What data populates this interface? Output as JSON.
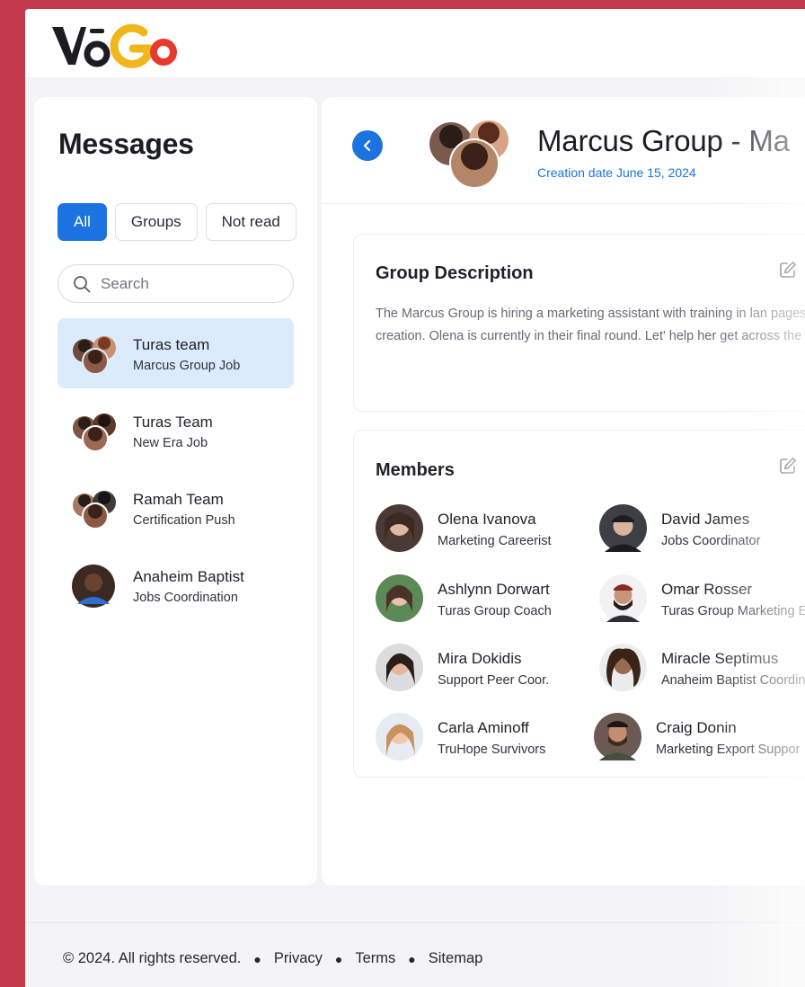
{
  "brand": {
    "logo_text": "VoGo",
    "accent": "#1a73e0",
    "background": "#c23a4b"
  },
  "sidebar": {
    "title": "Messages",
    "filters": [
      {
        "label": "All",
        "active": true
      },
      {
        "label": "Groups",
        "active": false
      },
      {
        "label": "Not read",
        "active": false
      }
    ],
    "search": {
      "placeholder": "Search",
      "icon": "search-icon"
    },
    "chats": [
      {
        "name": "Turas team",
        "subtitle": "Marcus Group Job",
        "selected": true
      },
      {
        "name": "Turas Team",
        "subtitle": "New Era Job",
        "selected": false
      },
      {
        "name": "Ramah Team",
        "subtitle": "Certification Push",
        "selected": false
      },
      {
        "name": "Anaheim Baptist",
        "subtitle": "Jobs Coordination",
        "selected": false
      }
    ]
  },
  "group": {
    "title": "Marcus Group - Ma",
    "creation_label": "Creation date",
    "creation_date": "June 15, 2024",
    "description": {
      "heading": "Group Description",
      "text": "The Marcus Group is hiring a marketing assistant with training in lan pages and funnel creation. Olena is currently in their final round. Let' help her get across the finish line!"
    },
    "members": {
      "heading": "Members",
      "list": [
        {
          "name": "Olena Ivanova",
          "role": "Marketing Careerist"
        },
        {
          "name": "David James",
          "role": "Jobs Coordinator"
        },
        {
          "name": "Ashlynn Dorwart",
          "role": "Turas Group Coach"
        },
        {
          "name": "Omar Rosser",
          "role": "Turas Group Marketing E"
        },
        {
          "name": "Mira Dokidis",
          "role": "Support Peer Coor."
        },
        {
          "name": "Miracle Septimus",
          "role": "Anaheim Baptist Coordin"
        },
        {
          "name": "Carla Aminoff",
          "role": "TruHope Survivors"
        },
        {
          "name": "Craig Donin",
          "role": "Marketing Export Suppor"
        }
      ]
    }
  },
  "footer": {
    "copyright": "© 2024. All rights reserved.",
    "links": [
      "Privacy",
      "Terms",
      "Sitemap"
    ]
  }
}
